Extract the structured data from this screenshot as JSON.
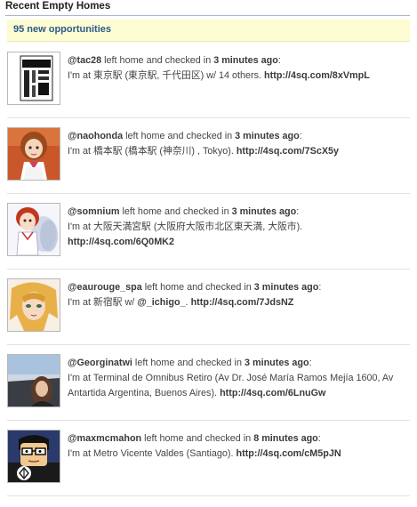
{
  "section_title": "Recent Empty Homes",
  "notice_text": "95 new opportunities",
  "checkins": [
    {
      "username": "@tac28",
      "phrase_before": " left home and checked in ",
      "time": "3 minutes ago",
      "after_time": ":",
      "msg_prefix": "I'm at 東京駅 (東京駅, 千代田区) w/ 14 others. ",
      "mention": "",
      "msg_after_mention": "",
      "link": "http://4sq.com/8xVmpL",
      "avatar_icon": "book-cover-avatar"
    },
    {
      "username": "@naohonda",
      "phrase_before": " left home and checked in ",
      "time": "3 minutes ago",
      "after_time": ":",
      "msg_prefix": "I'm at 橋本駅 (橋本駅 (神奈川) , Tokyo). ",
      "mention": "",
      "msg_after_mention": "",
      "link": "http://4sq.com/7ScX5y",
      "avatar_icon": "anime-girl-avatar"
    },
    {
      "username": "@somnium",
      "phrase_before": " left home and checked in ",
      "time": "3 minutes ago",
      "after_time": ":",
      "msg_prefix": "I'm at 大阪天満宮駅 (大阪府大阪市北区東天満, 大阪市). ",
      "mention": "",
      "msg_after_mention": "",
      "link": "http://4sq.com/6Q0MK2",
      "avatar_icon": "anime-redhead-avatar"
    },
    {
      "username": "@eaurouge_spa",
      "phrase_before": " left home and checked in ",
      "time": "3 minutes ago",
      "after_time": ":",
      "msg_prefix": "I'm at 新宿駅 w/ ",
      "mention": "@_ichigo_",
      "msg_after_mention": ". ",
      "link": "http://4sq.com/7JdsNZ",
      "avatar_icon": "anime-blonde-avatar"
    },
    {
      "username": "@Georginatwi",
      "phrase_before": " left home and checked in ",
      "time": "3 minutes ago",
      "after_time": ":",
      "msg_prefix": "I'm at Terminal de Omnibus Retiro (Av Dr. José María Ramos Mejía 1600, Av Antartida Argentina, Buenos Aires). ",
      "mention": "",
      "msg_after_mention": "",
      "link": "http://4sq.com/6LnuGw",
      "avatar_icon": "car-photo-avatar"
    },
    {
      "username": "@maxmcmahon",
      "phrase_before": " left home and checked in ",
      "time": "8 minutes ago",
      "after_time": ":",
      "msg_prefix": "I'm at Metro Vicente Valdes (Santiago). ",
      "mention": "",
      "msg_after_mention": "",
      "link": "http://4sq.com/cM5pJN",
      "avatar_icon": "cartoon-man-avatar"
    }
  ]
}
